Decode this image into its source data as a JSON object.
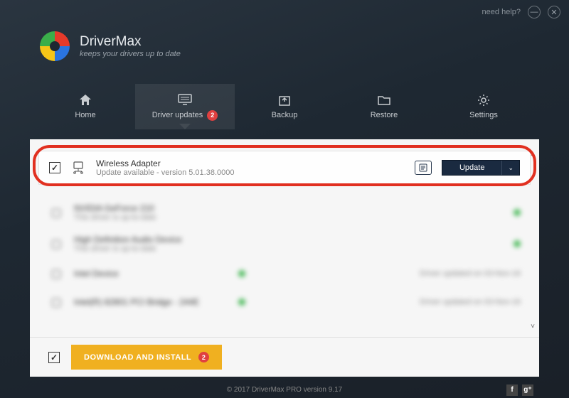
{
  "titlebar": {
    "help_label": "need help?"
  },
  "brand": {
    "title": "DriverMax",
    "tagline": "keeps your drivers up to date"
  },
  "nav": {
    "items": [
      {
        "label": "Home"
      },
      {
        "label": "Driver updates",
        "badge": "2",
        "active": true
      },
      {
        "label": "Backup"
      },
      {
        "label": "Restore"
      },
      {
        "label": "Settings"
      }
    ]
  },
  "drivers": {
    "highlighted": {
      "name": "Wireless Adapter",
      "sub": "Update available - version 5.01.38.0000",
      "update_label": "Update"
    },
    "others": [
      {
        "name": "NVIDIA GeForce 210",
        "sub": "This driver is up-to-date"
      },
      {
        "name": "High Definition Audio Device",
        "sub": "This driver is up-to-date"
      },
      {
        "name": "Intel Device",
        "sub": "",
        "right": "Driver updated on 03-Nov-16"
      },
      {
        "name": "Intel(R) 82801 PCI Bridge - 244E",
        "sub": "",
        "right": "Driver updated on 03-Nov-16"
      }
    ]
  },
  "footer_action": {
    "download_label": "DOWNLOAD AND INSTALL",
    "badge": "2"
  },
  "footer": {
    "copyright": "© 2017 DriverMax PRO version 9.17"
  }
}
